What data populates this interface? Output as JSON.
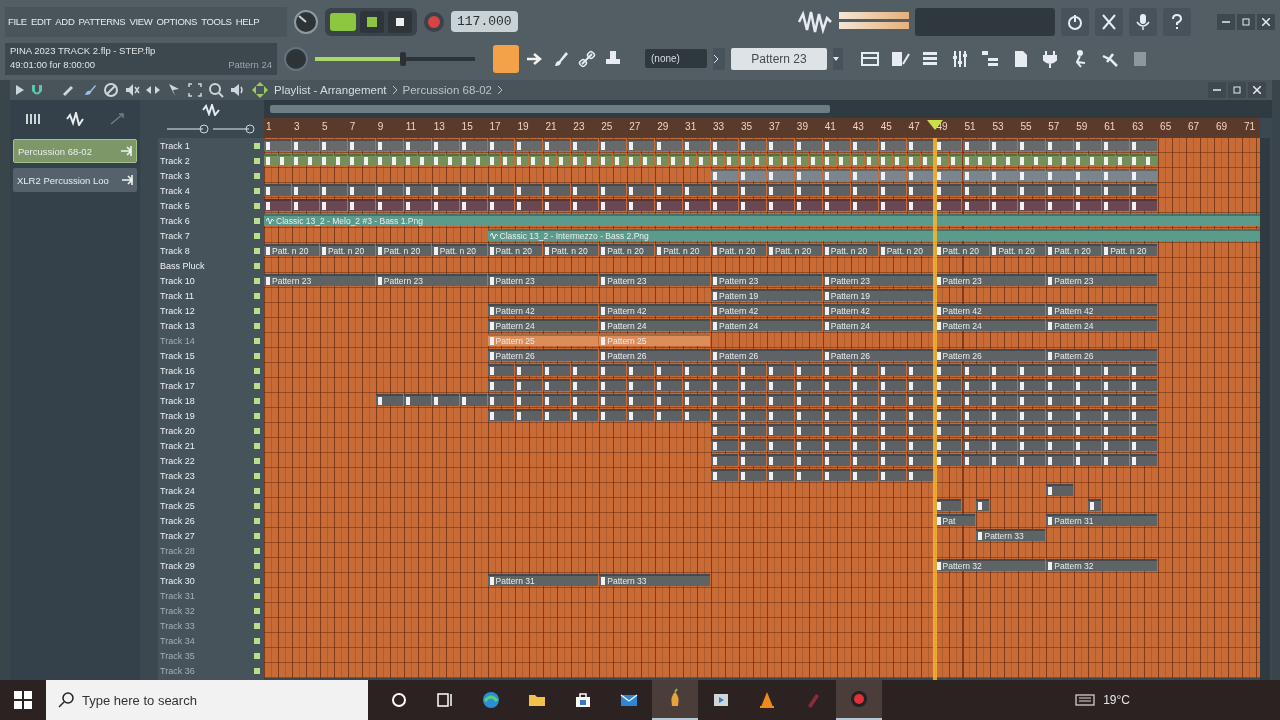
{
  "menu": [
    "FILE",
    "EDIT",
    "ADD",
    "PATTERNS",
    "VIEW",
    "OPTIONS",
    "TOOLS",
    "HELP"
  ],
  "transport": {
    "tempo": "117.000"
  },
  "song_info": {
    "title": "PINA 2023 TRACK 2.flp - STEP.flp",
    "time": "49:01:00 for 8:00:00",
    "pattern": "Pattern 24"
  },
  "master_volume": {
    "level": 0.55
  },
  "toolbar": {
    "channel_group": "(none)",
    "pattern": "Pattern 23"
  },
  "playlist": {
    "title": "Playlist - Arrangement",
    "breadcrumb": "Percussion 68-02",
    "picker": [
      {
        "label": "Percussion 68-02",
        "selected": true
      },
      {
        "label": "XLR2 Percussion Loo",
        "selected": false
      }
    ],
    "ruler": [
      "1",
      "3",
      "5",
      "7",
      "9",
      "11",
      "13",
      "15",
      "17",
      "19",
      "21",
      "23",
      "25",
      "27",
      "29",
      "31",
      "33",
      "35",
      "37",
      "39",
      "41",
      "43",
      "45",
      "47",
      "49",
      "51",
      "53",
      "55",
      "57",
      "59",
      "61",
      "63",
      "65",
      "67",
      "69",
      "71"
    ],
    "playhead": {
      "level": 0.667
    },
    "tracks": [
      {
        "name": "Track 1",
        "disabled": false,
        "clips": [
          {
            "kind": "pattern",
            "color": "#67696b"
          }
        ]
      },
      {
        "name": "Track 2",
        "disabled": false,
        "clips": [
          {
            "kind": "pattern",
            "color": "#74905a"
          }
        ]
      },
      {
        "name": "Track 3",
        "disabled": false,
        "clips": [
          {
            "kind": "pattern",
            "color": "#7d858c"
          }
        ]
      },
      {
        "name": "Track 4",
        "disabled": false,
        "clips": [
          {
            "kind": "pattern",
            "color": "#5e6163"
          }
        ]
      },
      {
        "name": "Track 5",
        "disabled": false,
        "clips": [
          {
            "kind": "pattern",
            "color": "#6a4751"
          }
        ]
      },
      {
        "name": "Track 6",
        "disabled": false,
        "clips": [
          {
            "kind": "audio",
            "label": "Classic 13_2 - Melo_2 #3 - Bass 1.Png",
            "color": "#5c9a8b"
          }
        ]
      },
      {
        "name": "Track 7",
        "disabled": false,
        "clips": [
          {
            "kind": "audio",
            "label": "Classic 13_2 - Intermezzo - Bass 2.Png",
            "color": "#5c9a8b"
          }
        ]
      },
      {
        "name": "Track 8",
        "disabled": false,
        "clips": [
          {
            "kind": "pattern",
            "label": "Patt. n 20",
            "color": "#5e6366"
          },
          {
            "kind": "pattern",
            "label": "Patt. n 20",
            "color": "#5e6366"
          },
          {
            "kind": "pattern",
            "label": "Patt. n 20",
            "color": "#5e6366"
          },
          {
            "kind": "pattern",
            "label": "Patt. n 20",
            "color": "#5e6366"
          },
          {
            "kind": "pattern",
            "label": "Patt. n 20",
            "color": "#5e6366"
          },
          {
            "kind": "pattern",
            "label": "Patt. n 20",
            "color": "#5e6366"
          },
          {
            "kind": "pattern",
            "label": "Patt. n 20",
            "color": "#5e6366"
          },
          {
            "kind": "pattern",
            "label": "Patt. n 20",
            "color": "#5e6366"
          },
          {
            "kind": "pattern",
            "label": "Patt. n 20",
            "color": "#5e6366"
          },
          {
            "kind": "pattern",
            "label": "Patt. n 20",
            "color": "#5e6366"
          },
          {
            "kind": "pattern",
            "label": "Patt. n 20",
            "color": "#5e6366"
          },
          {
            "kind": "pattern",
            "label": "Patt. n 20",
            "color": "#5e6366"
          },
          {
            "kind": "pattern",
            "label": "Patt. n 20",
            "color": "#5e6366"
          },
          {
            "kind": "pattern",
            "label": "Patt. n 20",
            "color": "#5e6366"
          },
          {
            "kind": "pattern",
            "label": "Patt. n 20",
            "color": "#5e6366"
          },
          {
            "kind": "pattern",
            "label": "Patt. n 20",
            "color": "#5e6366"
          }
        ]
      },
      {
        "name": "Bass Pluck",
        "disabled": false
      },
      {
        "name": "Track 10",
        "disabled": false,
        "clips": [
          {
            "kind": "pattern",
            "label": "Pattern 23",
            "color": "#5e6366"
          },
          {
            "kind": "pattern",
            "label": "Pattern 23",
            "color": "#5e6366"
          },
          {
            "kind": "pattern",
            "label": "Pattern 23",
            "color": "#5e6366"
          },
          {
            "kind": "pattern",
            "label": "Pattern 23",
            "color": "#5e6366"
          },
          {
            "kind": "pattern",
            "label": "Pattern 23",
            "color": "#5e6366"
          },
          {
            "kind": "pattern",
            "label": "Pattern 23",
            "color": "#5e6366"
          },
          {
            "kind": "pattern",
            "label": "Pattern 23",
            "color": "#5e6366"
          },
          {
            "kind": "pattern",
            "label": "Pattern 23",
            "color": "#5e6366"
          }
        ]
      },
      {
        "name": "Track 11",
        "disabled": false,
        "clips": [
          {
            "kind": "pattern",
            "label": "Pattern 19",
            "color": "#5e6366"
          },
          {
            "kind": "pattern",
            "label": "Pattern 19",
            "color": "#5e6366"
          }
        ]
      },
      {
        "name": "Track 12",
        "disabled": false,
        "clips": [
          {
            "kind": "pattern",
            "label": "Pattern 42",
            "color": "#5e6366"
          },
          {
            "kind": "pattern",
            "label": "Pattern 42",
            "color": "#5e6366"
          },
          {
            "kind": "pattern",
            "label": "Pattern 42",
            "color": "#5e6366"
          },
          {
            "kind": "pattern",
            "label": "Pattern 42",
            "color": "#5e6366"
          },
          {
            "kind": "pattern",
            "label": "Pattern 42",
            "color": "#5e6366"
          },
          {
            "kind": "pattern",
            "label": "Pattern 42",
            "color": "#5e6366"
          }
        ]
      },
      {
        "name": "Track 13",
        "disabled": false,
        "clips": [
          {
            "kind": "pattern",
            "label": "Pattern 24",
            "color": "#5e6366"
          },
          {
            "kind": "pattern",
            "label": "Pattern 24",
            "color": "#5e6366"
          },
          {
            "kind": "pattern",
            "label": "Pattern 24",
            "color": "#5e6366"
          },
          {
            "kind": "pattern",
            "label": "Pattern 24",
            "color": "#5e6366"
          },
          {
            "kind": "pattern",
            "label": "Pattern 24",
            "color": "#5e6366"
          },
          {
            "kind": "pattern",
            "label": "Pattern 24",
            "color": "#5e6366"
          }
        ]
      },
      {
        "name": "Track 14",
        "disabled": true,
        "clips": [
          {
            "kind": "pattern",
            "label": "Pattern 25",
            "color": "#dc8d5a"
          },
          {
            "kind": "pattern",
            "label": "Pattern 25",
            "color": "#dc8d5a"
          }
        ]
      },
      {
        "name": "Track 15",
        "disabled": false,
        "clips": [
          {
            "kind": "pattern",
            "label": "Pattern 26",
            "color": "#5e6366"
          },
          {
            "kind": "pattern",
            "label": "Pattern 26",
            "color": "#5e6366"
          },
          {
            "kind": "pattern",
            "label": "Pattern 26",
            "color": "#5e6366"
          },
          {
            "kind": "pattern",
            "label": "Pattern 26",
            "color": "#5e6366"
          },
          {
            "kind": "pattern",
            "label": "Pattern 26",
            "color": "#5e6366"
          },
          {
            "kind": "pattern",
            "label": "Pattern 26",
            "color": "#5e6366"
          }
        ]
      },
      {
        "name": "Track 16",
        "disabled": false,
        "clips": [
          {
            "kind": "pattern",
            "color": "#5e6163"
          }
        ]
      },
      {
        "name": "Track 17",
        "disabled": false,
        "clips": [
          {
            "kind": "pattern",
            "color": "#5e6163"
          }
        ]
      },
      {
        "name": "Track 18",
        "disabled": false,
        "clips": [
          {
            "kind": "pattern",
            "color": "#5e6163"
          }
        ]
      },
      {
        "name": "Track 19",
        "disabled": false,
        "clips": [
          {
            "kind": "pattern",
            "color": "#5e6163"
          }
        ]
      },
      {
        "name": "Track 20",
        "disabled": false,
        "clips": [
          {
            "kind": "pattern",
            "color": "#5e6163"
          }
        ]
      },
      {
        "name": "Track 21",
        "disabled": false,
        "clips": [
          {
            "kind": "pattern",
            "color": "#5e6163"
          }
        ]
      },
      {
        "name": "Track 22",
        "disabled": false,
        "clips": [
          {
            "kind": "pattern",
            "color": "#5e6163"
          }
        ]
      },
      {
        "name": "Track 23",
        "disabled": false,
        "clips": [
          {
            "kind": "pattern",
            "color": "#5e6163"
          }
        ]
      },
      {
        "name": "Track 24",
        "disabled": false,
        "clips": [
          {
            "kind": "pattern",
            "color": "#5e6163"
          }
        ]
      },
      {
        "name": "Track 25",
        "disabled": false,
        "clips": [
          {
            "kind": "pattern",
            "color": "#5e6163"
          },
          {
            "kind": "pattern",
            "color": "#5e6163"
          },
          {
            "kind": "pattern",
            "color": "#5e6163"
          }
        ]
      },
      {
        "name": "Track 26",
        "disabled": false,
        "clips": [
          {
            "kind": "pattern",
            "label": "Pat",
            "color": "#5e6366"
          },
          {
            "kind": "pattern",
            "label": "Pattern 31",
            "color": "#5e6366"
          }
        ]
      },
      {
        "name": "Track 27",
        "disabled": false,
        "clips": [
          {
            "kind": "pattern",
            "label": "Pattern 33",
            "color": "#5e6366"
          }
        ]
      },
      {
        "name": "Track 28",
        "disabled": true
      },
      {
        "name": "Track 29",
        "disabled": false,
        "clips": [
          {
            "kind": "pattern",
            "label": "Pattern 32",
            "color": "#5e6366"
          },
          {
            "kind": "pattern",
            "label": "Pattern 32",
            "color": "#5e6366"
          }
        ]
      },
      {
        "name": "Track 30",
        "disabled": false,
        "clips": [
          {
            "kind": "pattern",
            "label": "Pattern 31",
            "color": "#5e6366"
          },
          {
            "kind": "pattern",
            "label": "Pattern 33",
            "color": "#5e6366"
          }
        ]
      },
      {
        "name": "Track 31",
        "disabled": true
      },
      {
        "name": "Track 32",
        "disabled": true
      },
      {
        "name": "Track 33",
        "disabled": true
      },
      {
        "name": "Track 34",
        "disabled": true
      },
      {
        "name": "Track 35",
        "disabled": true
      },
      {
        "name": "Track 36",
        "disabled": true
      }
    ]
  },
  "taskbar": {
    "search_placeholder": "Type here to search",
    "apps": [
      {
        "selected": false
      },
      {
        "selected": false
      },
      {
        "selected": false
      },
      {
        "selected": false
      },
      {
        "selected": false
      },
      {
        "selected": false
      },
      {
        "selected": true
      },
      {
        "selected": false
      },
      {
        "selected": false
      },
      {
        "selected": false
      },
      {
        "selected": true
      }
    ],
    "temperature": "19°C"
  }
}
